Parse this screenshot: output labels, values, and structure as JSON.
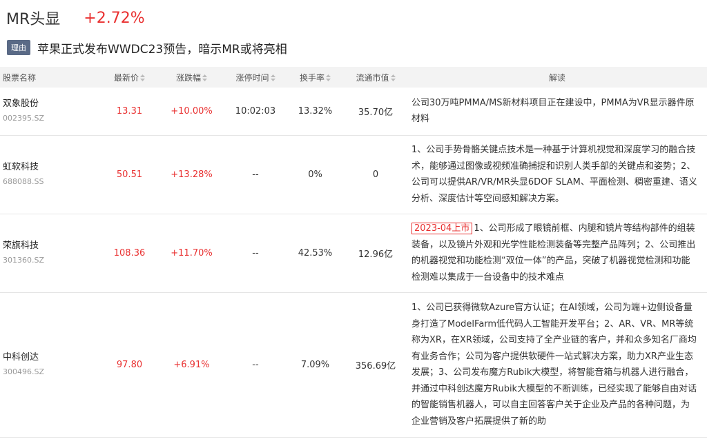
{
  "header": {
    "title": "MR头显",
    "change": "+2.72%"
  },
  "reason": {
    "badge": "理由",
    "text": "苹果正式发布WWDC23预告，暗示MR或将亮相"
  },
  "table": {
    "columns": {
      "name": "股票名称",
      "price": "最新价",
      "pct": "涨跌幅",
      "limit_time": "涨停时间",
      "turnover": "换手率",
      "mcap": "流通市值",
      "desc": "解读"
    },
    "rows": [
      {
        "name": "双象股份",
        "code": "002395.SZ",
        "price": "13.31",
        "pct": "+10.00%",
        "limit_time": "10:02:03",
        "turnover": "13.32%",
        "mcap": "35.70亿",
        "tag": "",
        "desc": "公司30万吨PMMA/MS新材料项目正在建设中，PMMA为VR显示器件原材料"
      },
      {
        "name": "虹软科技",
        "code": "688088.SS",
        "price": "50.51",
        "pct": "+13.28%",
        "limit_time": "--",
        "turnover": "0%",
        "mcap": "0",
        "tag": "",
        "desc": "1、公司手势骨骼关键点技术是一种基于计算机视觉和深度学习的融合技术，能够通过图像或视频准确捕捉和识别人类手部的关键点和姿势；2、公司可以提供AR/VR/MR头显6DOF SLAM、平面检测、稠密重建、语义分析、深度估计等空间感知解决方案。"
      },
      {
        "name": "荣旗科技",
        "code": "301360.SZ",
        "price": "108.36",
        "pct": "+11.70%",
        "limit_time": "--",
        "turnover": "42.53%",
        "mcap": "12.96亿",
        "tag": "2023-04上市",
        "desc": "1、公司形成了眼镜前框、内腿和镜片等结构部件的组装装备，以及镜片外观和光学性能检测装备等完整产品阵列；2、公司推出的机器视觉和功能检测“双位一体”的产品，突破了机器视觉检测和功能检测难以集成于一台设备中的技术难点"
      },
      {
        "name": "中科创达",
        "code": "300496.SZ",
        "price": "97.80",
        "pct": "+6.91%",
        "limit_time": "--",
        "turnover": "7.09%",
        "mcap": "356.69亿",
        "tag": "",
        "desc": "1、公司已获得微软Azure官方认证；在AI领域，公司为端+边侧设备量身打造了ModelFarm低代码人工智能开发平台；2、AR、VR、MR等统称为XR，在XR领域，公司支持了全产业链的客户，并和众多知名厂商均有业务合作；公司为客户提供软硬件一站式解决方案，助力XR产业生态发展；3、公司发布魔方Rubik大模型，将智能音箱与机器人进行融合，并通过中科创达魔方Rubik大模型的不断训练，已经实现了能够自由对话的智能销售机器人，可以自主回答客户关于企业及产品的各种问题，为企业营销及客户拓展提供了新的助"
      }
    ]
  }
}
